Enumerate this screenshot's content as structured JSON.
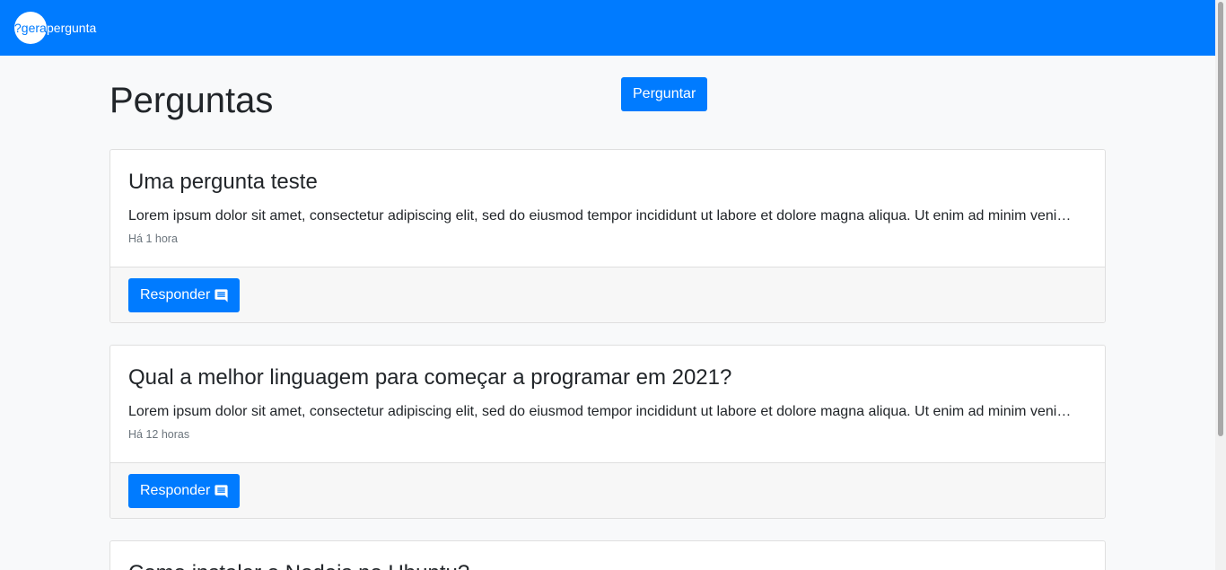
{
  "navbar": {
    "logo_text": "?gera",
    "brand_text": "pergunta"
  },
  "header": {
    "title": "Perguntas",
    "ask_button": "Perguntar"
  },
  "questions": [
    {
      "title": "Uma pergunta teste",
      "text": "Lorem ipsum dolor sit amet, consectetur adipiscing elit, sed do eiusmod tempor incididunt ut labore et dolore magna aliqua. Ut enim ad minim veniam, quis nostrud exercitation ullamco laboris nisi ut aliquip ex ea commodo consequat.",
      "time": "Há 1 hora",
      "reply_label": "Responder"
    },
    {
      "title": "Qual a melhor linguagem para começar a programar em 2021?",
      "text": "Lorem ipsum dolor sit amet, consectetur adipiscing elit, sed do eiusmod tempor incididunt ut labore et dolore magna aliqua. Ut enim ad minim veniam, quis nostrud exercitation ullamco laboris nisi ut aliquip ex ea commodo consequat.",
      "time": "Há 12 horas",
      "reply_label": "Responder"
    },
    {
      "title": "Como instalar o Nodejs no Ubuntu?"
    }
  ],
  "icons": {
    "reply": "comment-icon"
  },
  "colors": {
    "primary": "#007bff",
    "background": "#f8f9fa"
  }
}
